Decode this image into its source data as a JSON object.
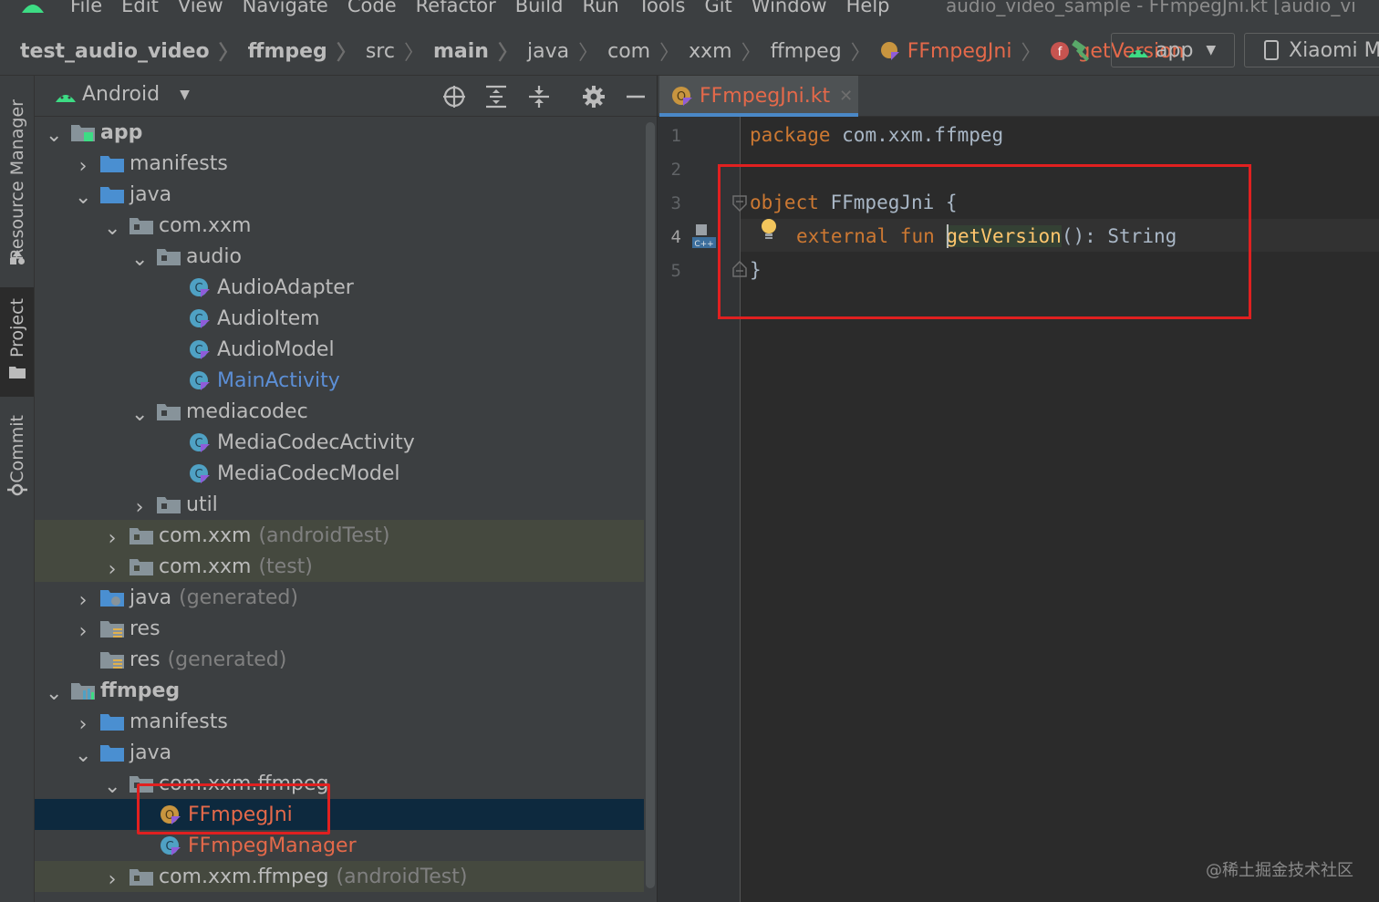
{
  "menubar": {
    "items": [
      "File",
      "Edit",
      "View",
      "Navigate",
      "Code",
      "Refactor",
      "Build",
      "Run",
      "Tools",
      "Git",
      "Window",
      "Help"
    ],
    "window_title": "audio_video_sample - FFmpegJni.kt [audio_vi"
  },
  "breadcrumb": {
    "items": [
      "test_audio_video",
      "ffmpeg",
      "src",
      "main",
      "java",
      "com",
      "xxm",
      "ffmpeg",
      "FFmpegJni",
      "getVersion"
    ]
  },
  "toolbar": {
    "run_config": "app",
    "device": "Xiaomi M"
  },
  "toolstrip": {
    "tabs": [
      "Resource Manager",
      "Project",
      "Commit"
    ]
  },
  "project_panel": {
    "view_mode": "Android",
    "tree": [
      {
        "label": "app"
      },
      {
        "label": "manifests"
      },
      {
        "label": "java"
      },
      {
        "label": "com.xxm"
      },
      {
        "label": "audio"
      },
      {
        "label": "AudioAdapter"
      },
      {
        "label": "AudioItem"
      },
      {
        "label": "AudioModel"
      },
      {
        "label": "MainActivity"
      },
      {
        "label": "mediacodec"
      },
      {
        "label": "MediaCodecActivity"
      },
      {
        "label": "MediaCodecModel"
      },
      {
        "label": "util"
      },
      {
        "label": "com.xxm",
        "suffix": "(androidTest)"
      },
      {
        "label": "com.xxm",
        "suffix": "(test)"
      },
      {
        "label": "java",
        "suffix": "(generated)"
      },
      {
        "label": "res"
      },
      {
        "label": "res",
        "suffix": "(generated)"
      },
      {
        "label": "ffmpeg"
      },
      {
        "label": "manifests"
      },
      {
        "label": "java"
      },
      {
        "label": "com.xxm.ffmpeg"
      },
      {
        "label": "FFmpegJni"
      },
      {
        "label": "FFmpegManager"
      },
      {
        "label": "com.xxm.ffmpeg",
        "suffix": "(androidTest)"
      }
    ]
  },
  "editor": {
    "tab_label": "FFmpegJni.kt",
    "line_numbers": [
      "1",
      "2",
      "3",
      "4",
      "5"
    ],
    "code": {
      "l1_kw": "package",
      "l1_rest": " com.xxm.ffmpeg",
      "l3_kw": "object",
      "l3_rest": " FFmpegJni {",
      "l4_kw1": "external",
      "l4_kw2": " fun ",
      "l4_fn": "getVersion",
      "l4_rest": "(): String",
      "l5": "}"
    }
  },
  "watermark": "@稀土掘金技术社区",
  "colors": {
    "accent_red": "#e02020",
    "keyword": "#cc7832",
    "function": "#ffc66d",
    "selection": "#0d293e"
  }
}
